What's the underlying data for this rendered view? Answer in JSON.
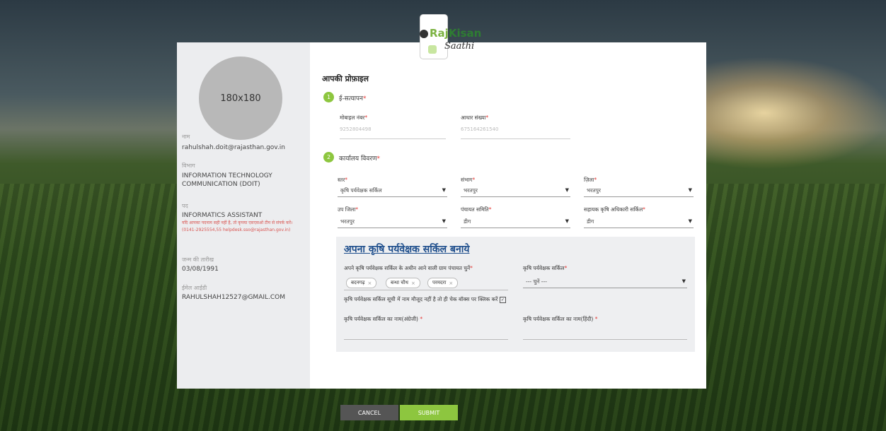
{
  "logo": {
    "part1": "Raj",
    "part2": "Kisan",
    "part3": "Saathi"
  },
  "sidebar": {
    "avatar_text": "180x180",
    "name_label": "नाम",
    "name_value": "rahulshah.doit@rajasthan.gov.in",
    "dept_label": "विभाग",
    "dept_value": "INFORMATION TECHNOLOGY COMMUNICATION (DOIT)",
    "post_label": "पद",
    "post_value": "INFORMATICS ASSISTANT",
    "warning": "यदि आपका पदनाम सही नहीं है, तो कृपया एसएसओ टीम से संपर्क करें।(0141-2925554,55 helpdesk.sso@rajasthan.gov.in)",
    "dob_label": "जन्म की तारीख",
    "dob_value": "03/08/1991",
    "email_label": "ईमेल आईडी",
    "email_value": "RAHULSHAH12527@GMAIL.COM"
  },
  "profile": {
    "title": "आपकी प्रोफ़ाइल",
    "step1": {
      "number": "1",
      "title": "ई-सत्यापन"
    },
    "mobile": {
      "label": "मोबाइल नंबर",
      "value": "9252804498"
    },
    "aadhaar": {
      "label": "आधार संख्या",
      "value": "675164261540"
    },
    "step2": {
      "number": "2",
      "title": "कार्यालय विवरण"
    },
    "fields": {
      "level": {
        "label": "स्तर",
        "value": "कृषि पर्यवेक्षक सर्किल"
      },
      "division": {
        "label": "संभाग",
        "value": "भरतपुर"
      },
      "district": {
        "label": "ज़िला",
        "value": "भरतपुर"
      },
      "subdistrict": {
        "label": "उप जिला",
        "value": "भरतपुर"
      },
      "panchayat_samiti": {
        "label": "पंचायत समिति",
        "value": "डीग"
      },
      "asst_circle": {
        "label": "सहायक कृषि अधिकारी सर्किल",
        "value": "डीग"
      }
    }
  },
  "panel": {
    "title": "अपना कृषि पर्यवेक्षक सर्किल बनाये",
    "gp_label": "अपने कृषि पर्यवेक्षक सर्किल के अधीन आने वाली ग्राम पंचायत चुनें",
    "chips": [
      "बदनगढ़",
      "बन्धा चौथ",
      "परमदरा"
    ],
    "circle_label": "कृषि पर्यवेक्षक सर्किल",
    "circle_placeholder": "--- चुनें ---",
    "checkbox_text": "कृषि पर्यवेक्षक सर्किल सूची में नाम मौजूद नहीं है तो ही चेक बॉक्स पर क्लिक करें",
    "name_en_label": "कृषि पर्यवेक्षक सर्किल का नाम(अंग्रेजी)",
    "name_hi_label": "कृषि पर्यवेक्षक सर्किल का नाम(हिंदी)"
  },
  "buttons": {
    "cancel": "CANCEL",
    "submit": "SUBMIT"
  },
  "colors": {
    "accent": "#8dc63f",
    "cancel": "#555555",
    "link_title": "#1e4e8c",
    "required": "#e53935"
  }
}
